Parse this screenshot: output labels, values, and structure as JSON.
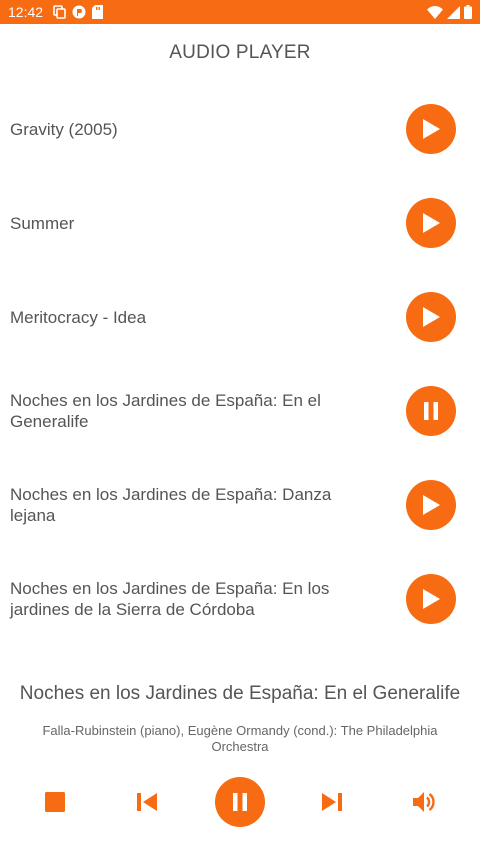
{
  "status_bar": {
    "time": "12:42",
    "left_icons": [
      "copy-icon",
      "app-icon",
      "sd-card-icon"
    ],
    "right_icons": [
      "wifi-icon",
      "signal-icon",
      "battery-icon"
    ],
    "color": "#f76b12"
  },
  "app": {
    "title": "AUDIO PLAYER",
    "accent_color": "#f76b12"
  },
  "tracks": [
    {
      "title": "Gravity (2005)",
      "state": "play",
      "icon": "play-icon"
    },
    {
      "title": "Summer",
      "state": "play",
      "icon": "play-icon"
    },
    {
      "title": "Meritocracy - Idea",
      "state": "play",
      "icon": "play-icon"
    },
    {
      "title": "Noches en los Jardines de España: En el Generalife",
      "state": "pause",
      "icon": "pause-icon"
    },
    {
      "title": "Noches en los Jardines de España: Danza lejana",
      "state": "play",
      "icon": "play-icon"
    },
    {
      "title": "Noches en los Jardines de España: En los jardines de la Sierra de Córdoba",
      "state": "play",
      "icon": "play-icon"
    }
  ],
  "now_playing": {
    "title": "Noches en los Jardines de España: En el Generalife",
    "artist": "Falla-Rubinstein (piano), Eugène Ormandy (cond.): The Philadelphia Orchestra"
  },
  "controls": {
    "stop": "stop-icon",
    "previous": "skip-previous-icon",
    "play_pause": "pause-icon",
    "next": "skip-next-icon",
    "volume": "volume-icon"
  }
}
